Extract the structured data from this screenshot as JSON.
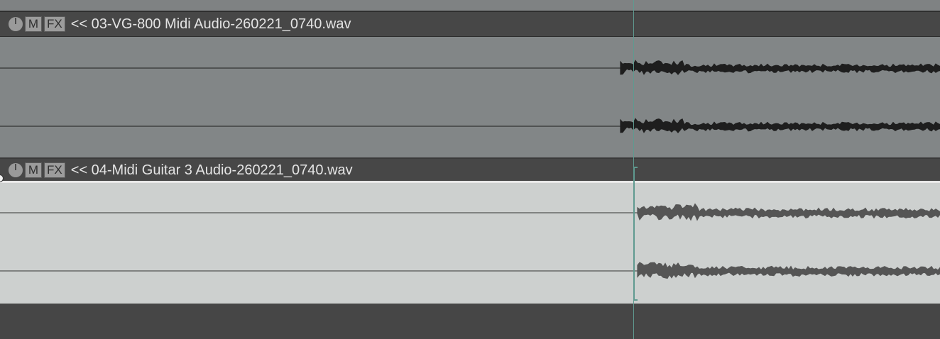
{
  "tracks": [
    {
      "take_name": "<< 03-VG-800 Midi Audio-260221_0740.wav",
      "buttons": {
        "mute": "M",
        "fx": "FX"
      },
      "selected": false
    },
    {
      "take_name": "<< 04-Midi Guitar 3 Audio-260221_0740.wav",
      "buttons": {
        "mute": "M",
        "fx": "FX"
      },
      "selected": true
    }
  ],
  "colors": {
    "cursor": "#5f9a90",
    "item1_bg": "#828687",
    "item2_bg": "#cdd0cf",
    "waveform_dark": "#1e1e1e",
    "waveform_light": "#555555"
  }
}
